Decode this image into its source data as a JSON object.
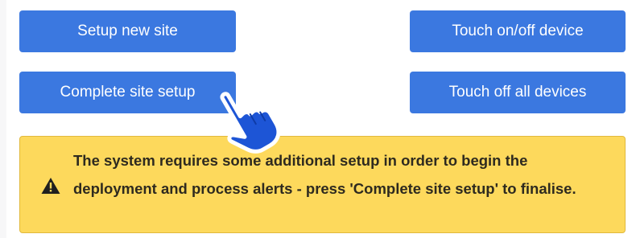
{
  "buttons": {
    "setup_new_site": "Setup new site",
    "touch_on_off_device": "Touch on/off device",
    "complete_site_setup": "Complete site setup",
    "touch_off_all_devices": "Touch off all devices"
  },
  "alert": {
    "message": "The system requires some additional setup in order to begin the deployment and process alerts - press 'Complete site setup' to finalise.",
    "icon": "warning-triangle-icon"
  },
  "pointer": {
    "icon": "hand-pointer-cursor-icon"
  },
  "colors": {
    "button": "#3b78e0",
    "alert_background": "#fdd95c",
    "alert_border": "#e1b93d",
    "hand_pointer": "#1d55d6"
  }
}
